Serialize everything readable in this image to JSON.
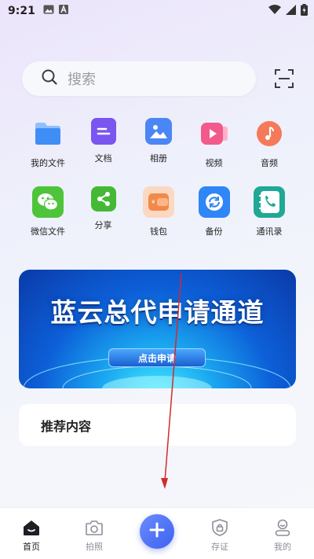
{
  "status_bar": {
    "time": "9:21"
  },
  "search": {
    "placeholder": "搜索"
  },
  "apps": [
    {
      "label": "我的文件",
      "icon": "folder-icon",
      "color": "#3f8ef6"
    },
    {
      "label": "文档",
      "icon": "document-icon",
      "color": "#7a55f0"
    },
    {
      "label": "相册",
      "icon": "image-icon",
      "color": "#4a86f5"
    },
    {
      "label": "视频",
      "icon": "video-icon",
      "color": "#f25a8c"
    },
    {
      "label": "音频",
      "icon": "music-icon",
      "color": "#f47a5a"
    },
    {
      "label": "微信文件",
      "icon": "wechat-icon",
      "color": "#4ec43a"
    },
    {
      "label": "分享",
      "icon": "share-icon",
      "color": "#45b936"
    },
    {
      "label": "钱包",
      "icon": "wallet-icon",
      "color": "#f08a4a"
    },
    {
      "label": "备份",
      "icon": "backup-icon",
      "color": "#2f86f6"
    },
    {
      "label": "通讯录",
      "icon": "contacts-phone-icon",
      "color": "#1fa896"
    }
  ],
  "banner": {
    "title": "蓝云总代申请通道",
    "button": "点击申请"
  },
  "recommend": {
    "title": "推荐内容"
  },
  "tabs": [
    {
      "label": "首页",
      "icon": "home-icon",
      "active": true
    },
    {
      "label": "拍照",
      "icon": "camera-icon",
      "active": false
    },
    {
      "label": "存证",
      "icon": "shield-lock-icon",
      "active": false
    },
    {
      "label": "我的",
      "icon": "profile-icon",
      "active": false
    }
  ],
  "fab": {
    "icon": "plus-icon"
  }
}
